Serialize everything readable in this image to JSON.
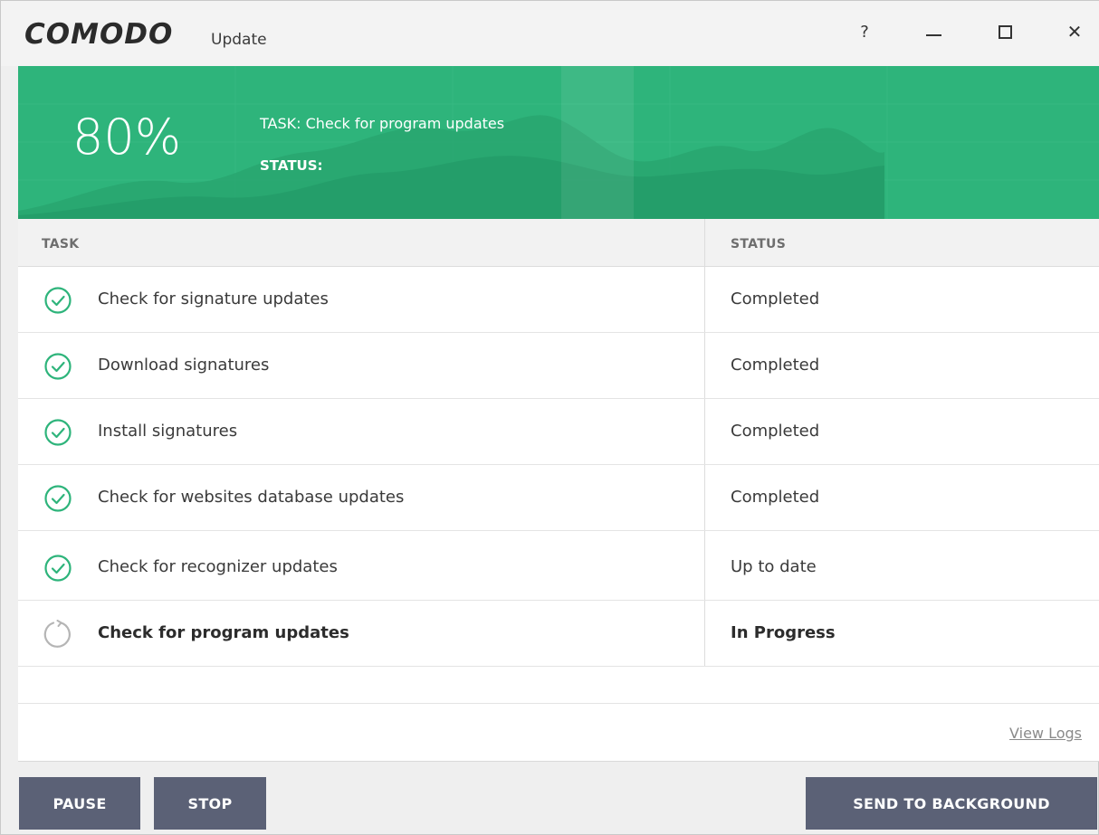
{
  "titlebar": {
    "logo": "COMODO",
    "title": "Update",
    "help": "?",
    "close": "✕"
  },
  "progress": {
    "percent_label": "80%",
    "value": 0.8,
    "task_label": "TASK: Check for program updates",
    "status_label": "STATUS:"
  },
  "table": {
    "columns": [
      "TASK",
      "STATUS"
    ],
    "rows": [
      {
        "task": "Check for signature updates",
        "status": "Completed",
        "state": "done"
      },
      {
        "task": "Download signatures",
        "status": "Completed",
        "state": "done"
      },
      {
        "task": "Install signatures",
        "status": "Completed",
        "state": "done"
      },
      {
        "task": "Check for websites database updates",
        "status": "Completed",
        "state": "done"
      },
      {
        "task": "Check for recognizer updates",
        "status": "Up to date",
        "state": "done"
      },
      {
        "task": "Check for program updates",
        "status": "In Progress",
        "state": "in-progress"
      }
    ]
  },
  "links": {
    "view_logs": "View Logs"
  },
  "buttons": {
    "pause": "PAUSE",
    "stop": "STOP",
    "send_to_background": "SEND TO BACKGROUND"
  },
  "colors": {
    "header_green": "#2eb47b",
    "check_green": "#2eb47b",
    "button_slate": "#5b6176"
  },
  "icons": {
    "done": "check-circle-icon",
    "in_progress": "spinner-icon"
  }
}
